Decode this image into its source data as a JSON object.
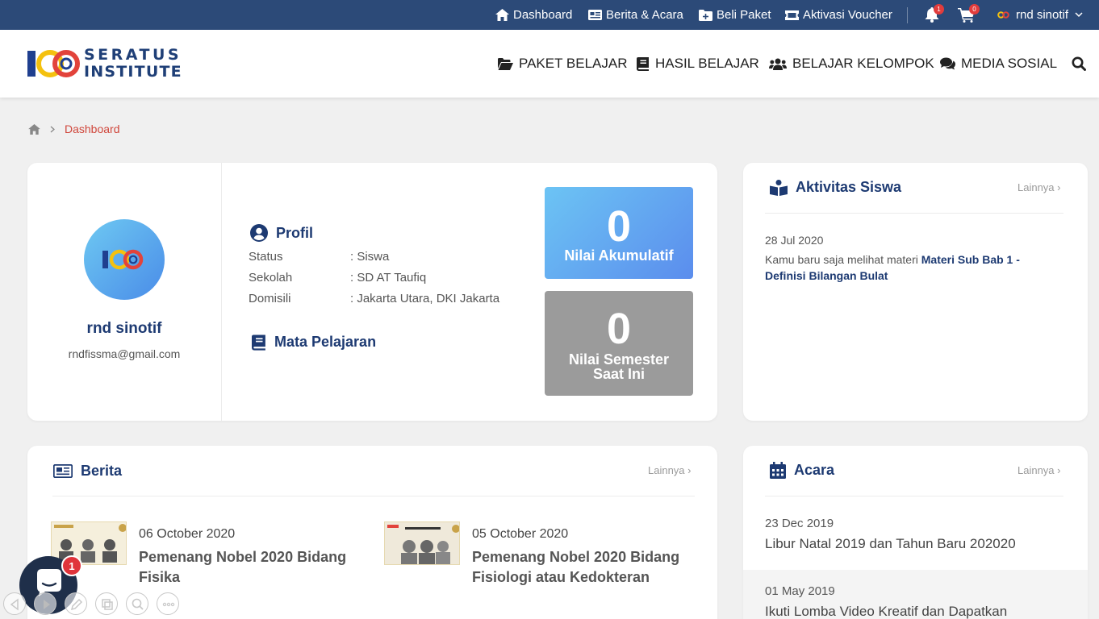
{
  "topbar": {
    "links": [
      "Dashboard",
      "Berita & Acara",
      "Beli Paket",
      "Aktivasi Voucher"
    ],
    "notif_count": "1",
    "cart_count": "0",
    "user_name": "rnd sinotif"
  },
  "header": {
    "logo_line1": "SERATUS",
    "logo_line2": "INSTITUTE",
    "nav": [
      "PAKET BELAJAR",
      "HASIL BELAJAR",
      "BELAJAR KELOMPOK",
      "MEDIA SOSIAL"
    ]
  },
  "breadcrumb": {
    "current": "Dashboard"
  },
  "profile": {
    "name": "rnd sinotif",
    "email": "rndfissma@gmail.com",
    "section_title": "Profil",
    "rows": [
      {
        "label": "Status",
        "value": ": Siswa"
      },
      {
        "label": "Sekolah",
        "value": ": SD AT Taufiq"
      },
      {
        "label": "Domisili",
        "value": ": Jakarta Utara, DKI Jakarta"
      }
    ],
    "subjects_title": "Mata Pelajaran",
    "score1": {
      "value": "0",
      "label": "Nilai Akumulatif"
    },
    "score2": {
      "value": "0",
      "label_line1": "Nilai Semester",
      "label_line2": "Saat Ini"
    }
  },
  "activity": {
    "title": "Aktivitas Siswa",
    "more": "Lainnya",
    "date": "28 Jul 2020",
    "text": "Kamu baru saja melihat materi ",
    "link_text": "Materi Sub Bab 1 - Definisi Bilangan Bulat"
  },
  "news": {
    "title": "Berita",
    "more": "Lainnya",
    "items": [
      {
        "date": "06 October 2020",
        "title": "Pemenang Nobel 2020 Bidang Fisika"
      },
      {
        "date": "05 October 2020",
        "title": "Pemenang Nobel 2020 Bidang Fisiologi atau Kedokteran"
      }
    ]
  },
  "events": {
    "title": "Acara",
    "more": "Lainnya",
    "items": [
      {
        "date": "23 Dec 2019",
        "title": "Libur Natal 2019 dan Tahun Baru 202020"
      },
      {
        "date": "01 May 2019",
        "title": "Ikuti Lomba Video Kreatif dan Dapatkan"
      }
    ]
  },
  "chat": {
    "badge": "1"
  },
  "colors": {
    "topbar": "#2c4a78",
    "accent": "#1d3a72",
    "breadcrumb_active": "#d0473c",
    "score1": "#5ea6f0",
    "score2": "#9b9b9b"
  }
}
